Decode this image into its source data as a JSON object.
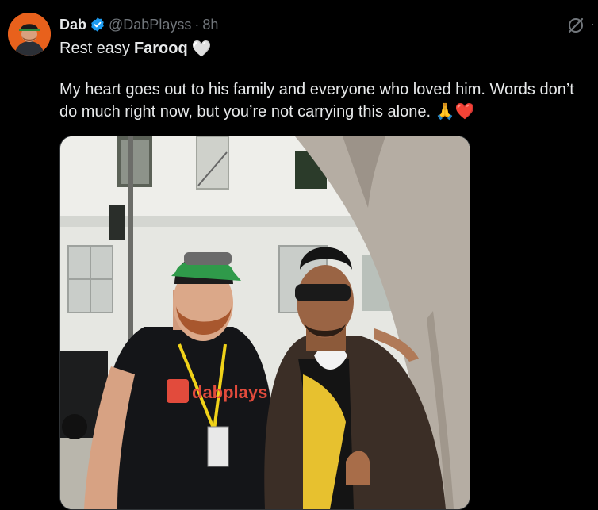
{
  "tweet": {
    "display_name": "Dab",
    "handle": "@DabPlayss",
    "separator": "·",
    "time": "8h",
    "line1_prefix": "Rest easy",
    "line1_bold": "Farooq",
    "line1_emoji": "🤍",
    "body_text": "My heart goes out to his family and everyone who loved him. Words don’t do much right now, but you’re not carrying this alone.",
    "body_emoji_1": "🙏",
    "body_emoji_2": "❤️",
    "shirt_logo_text": "dabplays"
  },
  "icons": {
    "verified": "verified-badge-icon",
    "grok": "grok-icon",
    "more": "more-icon"
  },
  "colors": {
    "background": "#000000",
    "text": "#e7e9ea",
    "muted": "#71767b",
    "verified": "#1d9bf0",
    "avatar_bg": "#e8611c"
  }
}
